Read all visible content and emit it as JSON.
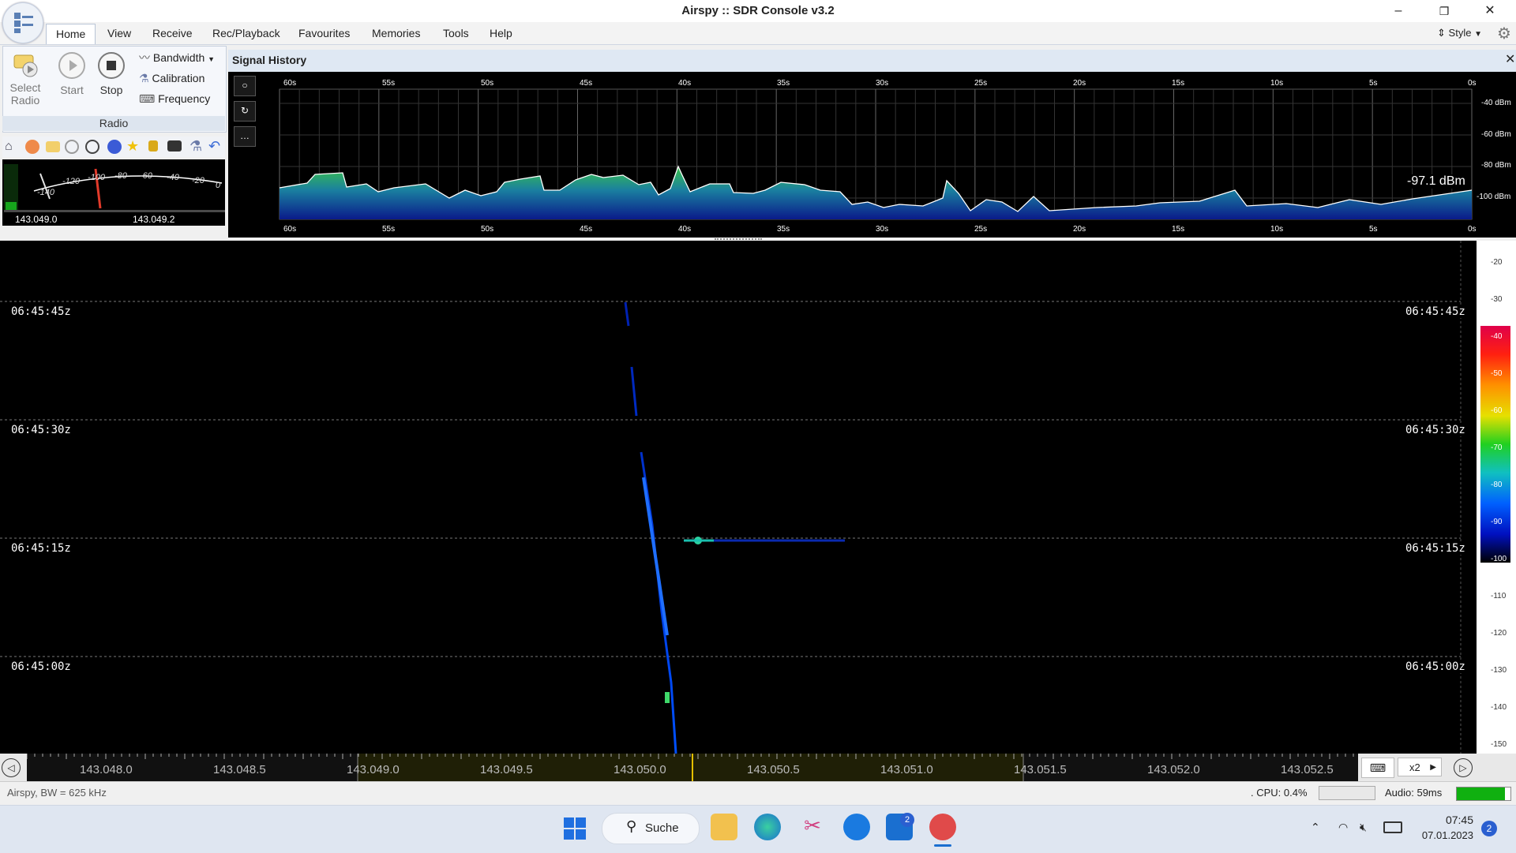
{
  "window": {
    "title": "Airspy :: SDR Console v3.2",
    "minimize": "–",
    "restore": "❐",
    "close": "✕"
  },
  "menu": {
    "tabs": [
      "Home",
      "View",
      "Receive",
      "Rec/Playback",
      "Favourites",
      "Memories",
      "Tools",
      "Help"
    ],
    "style_label": "Style"
  },
  "ribbon": {
    "select_radio": [
      "Select",
      "Radio"
    ],
    "start": "Start",
    "stop": "Stop",
    "bandwidth": "Bandwidth",
    "calibration": "Calibration",
    "frequency": "Frequency",
    "group_label": "Radio"
  },
  "smeter": {
    "scale": [
      "-140",
      "-120",
      "-100",
      "-80",
      "-60",
      "-40",
      "-20",
      "0"
    ],
    "freq_left": "143.049.0",
    "freq_right": "143.049.2"
  },
  "signal_history": {
    "title": "Signal History",
    "time_ticks": [
      "60s",
      "55s",
      "50s",
      "45s",
      "40s",
      "35s",
      "30s",
      "25s",
      "20s",
      "15s",
      "10s",
      "5s",
      "0s"
    ],
    "level_ticks": [
      "-40 dBm",
      "-60 dBm",
      "-80 dBm",
      "-100 dBm"
    ],
    "current_level": "-97.1 dBm",
    "side_buttons": [
      "○",
      "↻",
      "…"
    ]
  },
  "waterfall": {
    "timestamps": [
      "06:45:45z",
      "06:45:30z",
      "06:45:15z",
      "06:45:00z"
    ],
    "scale_ticks": [
      "-20",
      "-30",
      "-40",
      "-50",
      "-60",
      "-70",
      "-80",
      "-90",
      "-100",
      "-110",
      "-120",
      "-130",
      "-140",
      "-150"
    ],
    "colors": {
      "high": "#e0004a",
      "mid": "#ff9000",
      "low": "#0020ff"
    }
  },
  "frequency_axis": {
    "labels": [
      "143.048.0",
      "143.048.5",
      "143.049.0",
      "143.049.5",
      "143.050.0",
      "143.050.5",
      "143.051.0",
      "143.051.5",
      "143.052.0",
      "143.052.5"
    ],
    "zoom": "x2"
  },
  "status": {
    "left": "Airspy, BW = 625 kHz",
    "cpu": ". CPU: 0.4%",
    "audio": "Audio: 59ms"
  },
  "taskbar": {
    "search": "Suche",
    "time": "07:45",
    "date": "07.01.2023",
    "notification_count": "2",
    "mail_badge": "2"
  }
}
